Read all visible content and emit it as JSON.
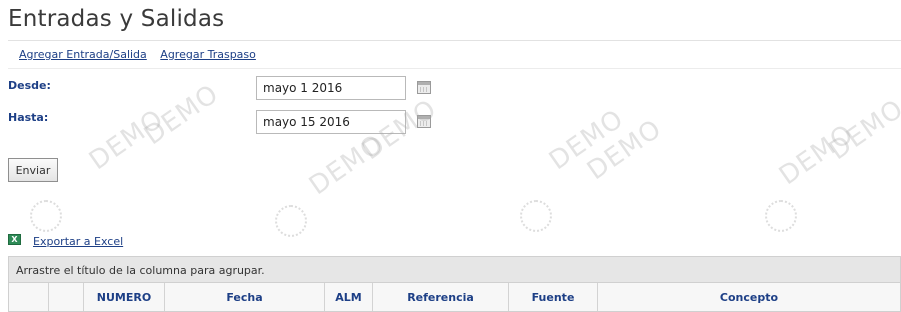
{
  "page": {
    "title": "Entradas y Salidas"
  },
  "links": {
    "add_entry": "Agregar Entrada/Salida",
    "add_transfer": "Agregar Traspaso"
  },
  "filters": {
    "from_label": "Desde:",
    "from_value": "mayo 1 2016",
    "to_label": "Hasta:",
    "to_value": "mayo 15 2016"
  },
  "submit_label": "Enviar",
  "export": {
    "icon": "excel-icon",
    "label": "Exportar a Excel"
  },
  "grid": {
    "group_hint": "Arrastre el título de la columna para agrupar.",
    "columns": [
      "",
      "",
      "NUMERO",
      "Fecha",
      "ALM",
      "Referencia",
      "Fuente",
      "Concepto"
    ]
  },
  "watermark": "DEMO"
}
